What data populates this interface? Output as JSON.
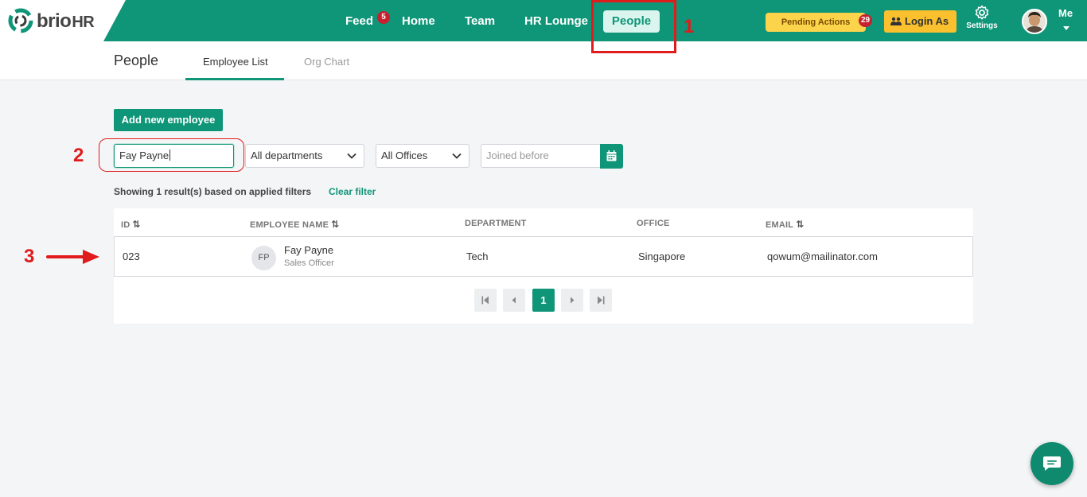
{
  "brand": {
    "logo_main": "brio",
    "logo_suffix": "HR"
  },
  "nav": {
    "feed": {
      "label": "Feed",
      "badge": "5"
    },
    "home": "Home",
    "team": "Team",
    "hr_lounge": "HR Lounge",
    "people": "People"
  },
  "header_actions": {
    "pending": {
      "label": "Pending Actions",
      "badge": "29"
    },
    "login_as": "Login As",
    "settings": "Settings",
    "me": "Me"
  },
  "subheader": {
    "title": "People",
    "tabs": [
      {
        "label": "Employee List",
        "active": true
      },
      {
        "label": "Org Chart",
        "active": false
      }
    ]
  },
  "controls": {
    "add_button": "Add new employee",
    "search_value": "Fay Payne",
    "department": "All departments",
    "office": "All Offices",
    "joined_placeholder": "Joined before"
  },
  "results": {
    "summary": "Showing 1 result(s) based on applied filters",
    "clear": "Clear filter"
  },
  "table": {
    "columns": [
      "ID",
      "EMPLOYEE NAME",
      "DEPARTMENT",
      "OFFICE",
      "EMAIL"
    ],
    "rows": [
      {
        "id": "023",
        "initials": "FP",
        "name": "Fay Payne",
        "title": "Sales Officer",
        "department": "Tech",
        "office": "Singapore",
        "email": "qowum@mailinator.com"
      }
    ],
    "current_page": "1"
  },
  "annotations": {
    "one": "1",
    "two": "2",
    "three": "3"
  },
  "colors": {
    "primary": "#0f9577",
    "badge": "#c8202f",
    "annotation": "#e01b1b",
    "pending": "#fbd44c",
    "login_as": "#fbc02d"
  }
}
